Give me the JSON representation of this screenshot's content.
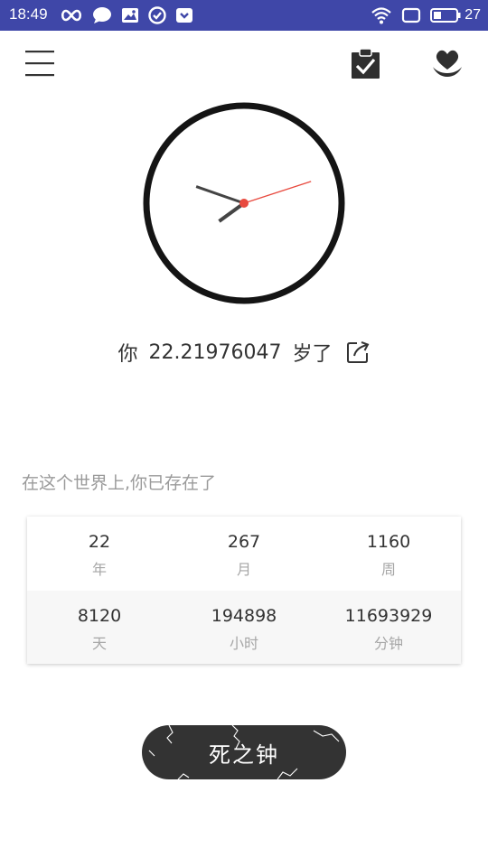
{
  "status_bar": {
    "time": "18:49",
    "battery_level": "27",
    "icons_left": [
      "infinity-icon",
      "chat-bubble-icon",
      "gallery-icon",
      "check-circle-icon",
      "pocket-icon"
    ],
    "icons_right": [
      "wifi-icon",
      "square-icon",
      "battery-icon"
    ]
  },
  "toolbar": {
    "menu_icon": "hamburger-menu-icon",
    "checklist_icon": "clipboard-check-icon",
    "heart_icon": "heart-in-hands-icon"
  },
  "clock": {
    "hour": 7,
    "minute": 48,
    "second": 12
  },
  "age": {
    "prefix": "你",
    "value": "22.21976047",
    "suffix": "岁了"
  },
  "existence": {
    "caption": "在这个世界上,你已存在了",
    "stats": [
      {
        "value": "22",
        "unit": "年"
      },
      {
        "value": "267",
        "unit": "月"
      },
      {
        "value": "1160",
        "unit": "周"
      },
      {
        "value": "8120",
        "unit": "天"
      },
      {
        "value": "194898",
        "unit": "小时"
      },
      {
        "value": "11693929",
        "unit": "分钟"
      }
    ]
  },
  "death_button": {
    "label": "死之钟"
  },
  "colors": {
    "status_bar": "#3f47a8",
    "clock_second_hand": "#e84a3f",
    "button_dark": "#333333"
  }
}
